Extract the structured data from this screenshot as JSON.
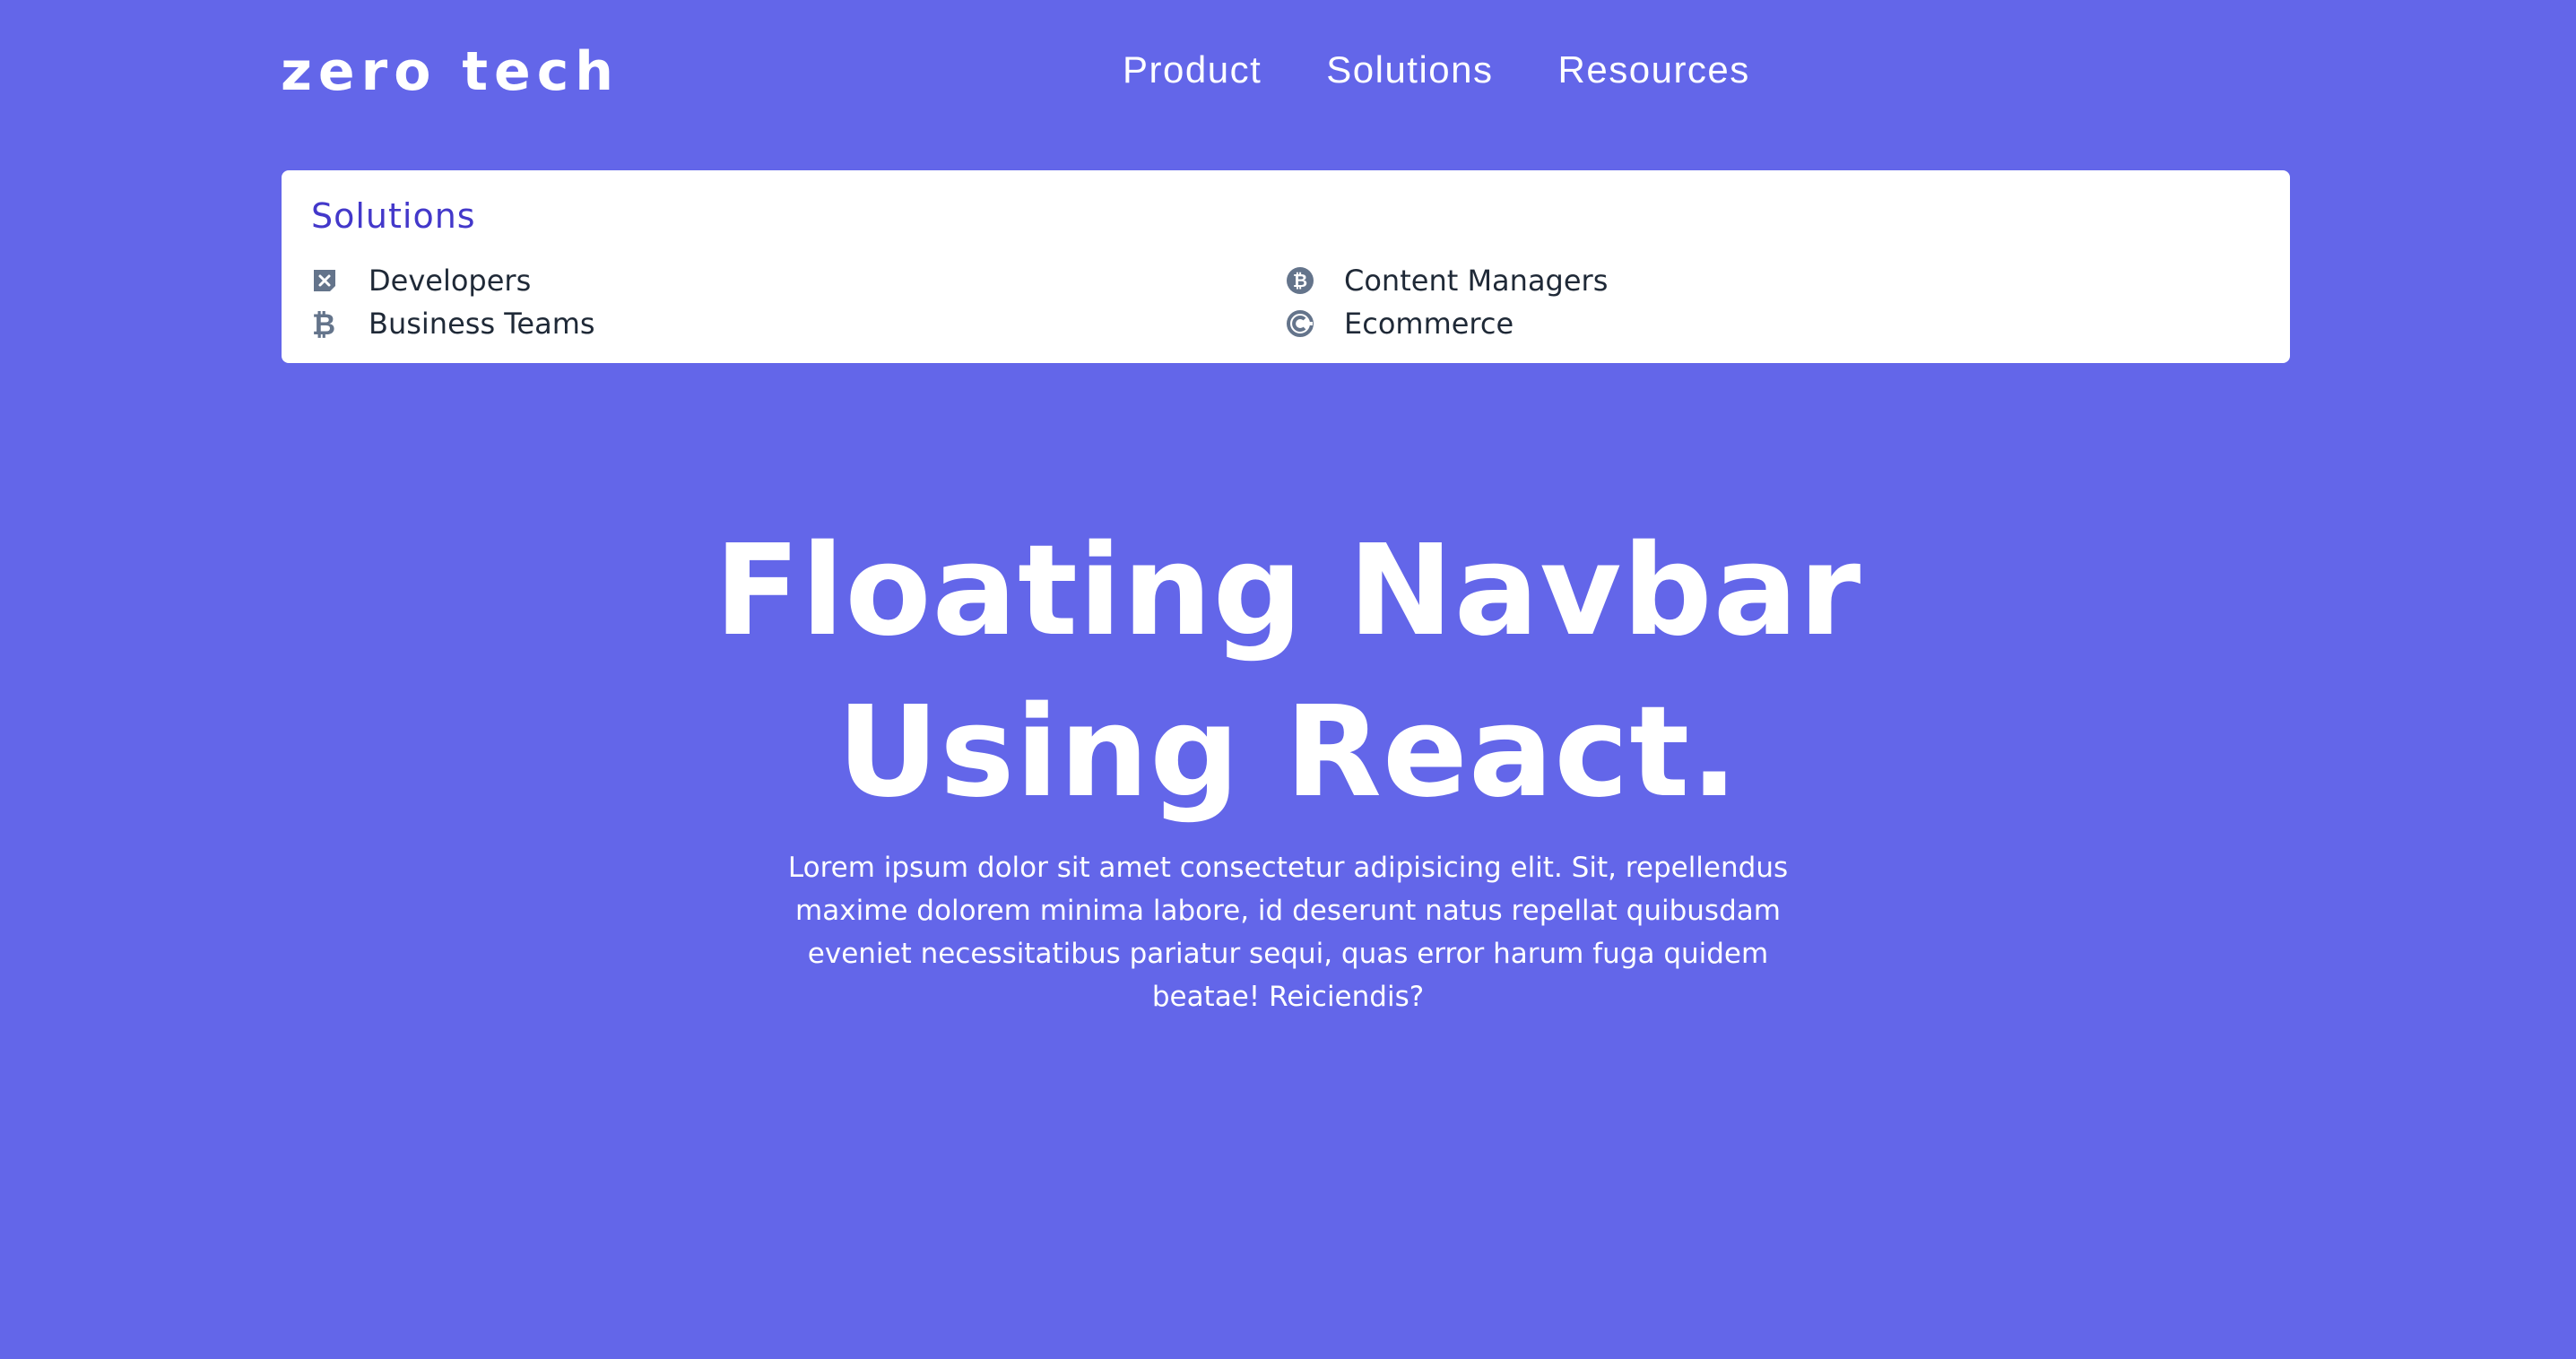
{
  "nav": {
    "logo": "zero tech",
    "links": [
      "Product",
      "Solutions",
      "Resources"
    ]
  },
  "dropdown": {
    "title": "Solutions",
    "items": [
      {
        "label": "Developers",
        "icon": "x-card-icon"
      },
      {
        "label": "Content Managers",
        "icon": "bitcoin-circle-icon"
      },
      {
        "label": "Business Teams",
        "icon": "bitcoin-icon"
      },
      {
        "label": "Ecommerce",
        "icon": "circular-c-icon"
      }
    ]
  },
  "hero": {
    "title_line1": "Floating Navbar",
    "title_line2": "Using React.",
    "text": "Lorem ipsum dolor sit amet consectetur adipisicing elit. Sit, repellendus maxime dolorem minima labore, id deserunt natus repellat quibusdam eveniet necessitatibus pariatur sequi, quas error harum fuga quidem beatae! Reiciendis?"
  },
  "colors": {
    "background": "#6366e9",
    "dropdown_title": "#4338ca",
    "icon": "#64748b",
    "text_dark": "#1f2937"
  }
}
